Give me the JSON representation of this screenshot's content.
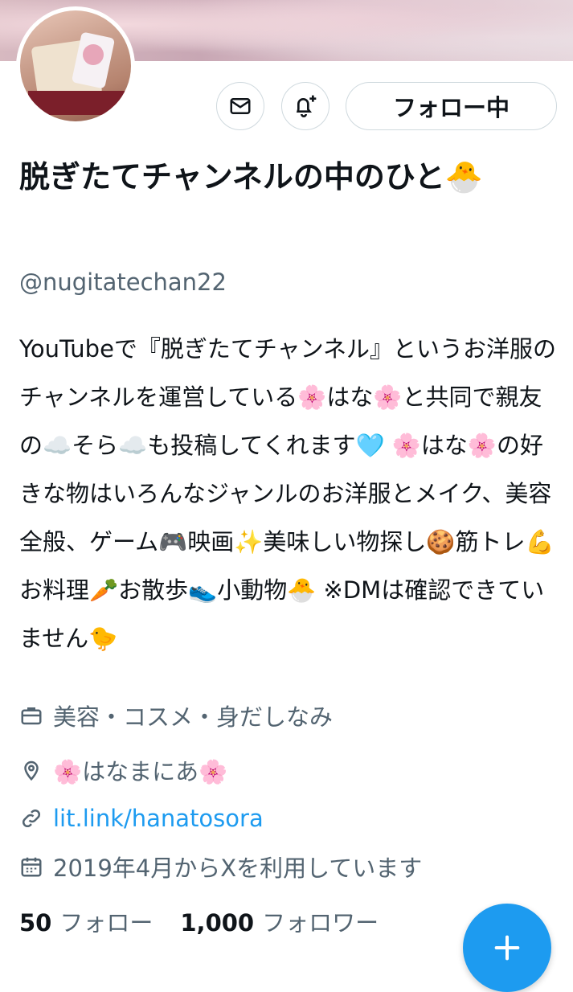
{
  "header": {
    "follow_label": "フォロー中"
  },
  "profile": {
    "name": "脱ぎたてチャンネルの中のひと🐣",
    "handle": "@nugitatechan22",
    "bio": "YouTubeで『脱ぎたてチャンネル』というお洋服のチャンネルを運営している🌸はな🌸と共同で親友の☁️そら☁️も投稿してくれます🩵 🌸はな🌸の好きな物はいろんなジャンルのお洋服とメイク、美容全般、ゲーム🎮映画✨美味しい物探し🍪筋トレ💪お料理🥕お散歩👟小動物🐣 ※DMは確認できていません🐤",
    "category": "美容・コスメ・身だしなみ",
    "location": "🌸はなまにあ🌸",
    "website": "lit.link/hanatosora",
    "joined": "2019年4月からXを利用しています"
  },
  "stats": {
    "following_count": "50",
    "following_label": "フォロー",
    "followers_count": "1,000",
    "followers_label": "フォロワー"
  },
  "icons": {
    "message": "mail-icon",
    "notify": "bell-plus-icon",
    "category": "briefcase-icon",
    "location": "pin-icon",
    "website": "link-icon",
    "joined": "calendar-icon",
    "compose": "plus-icon"
  },
  "colors": {
    "accent": "#1d9bf0",
    "text": "#0f1419",
    "muted": "#536471"
  }
}
